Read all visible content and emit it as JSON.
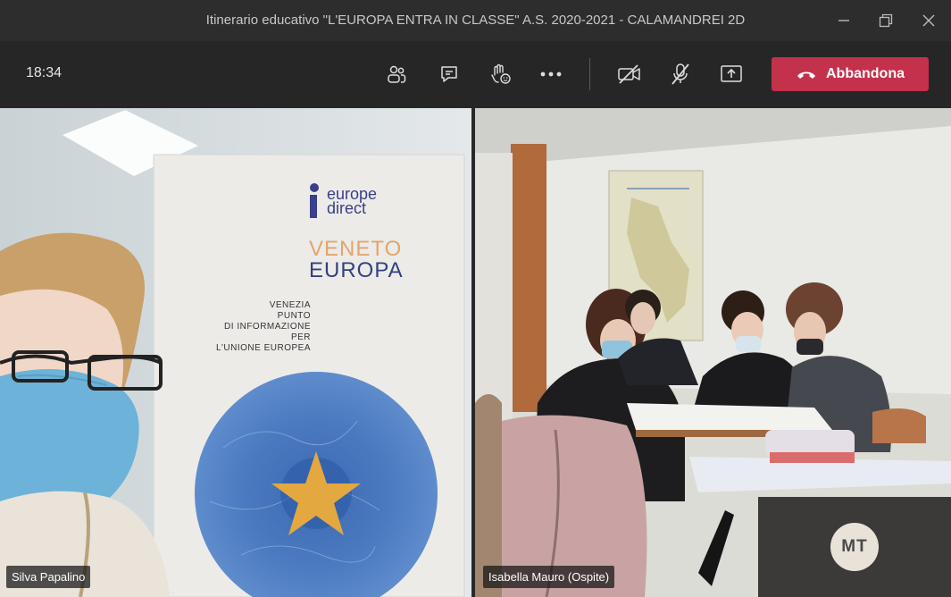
{
  "window": {
    "title": "Itinerario educativo \"L'EUROPA ENTRA IN CLASSE\" A.S. 2020-2021 - CALAMANDREI 2D"
  },
  "toolbar": {
    "clock": "18:34",
    "leave_label": "Abbandona",
    "icons": [
      "participants-icon",
      "chat-icon",
      "raise-hand-icon",
      "more-icon",
      "camera-off-icon",
      "mic-off-icon",
      "share-screen-icon",
      "phone-icon"
    ]
  },
  "banner": {
    "brand_line1": "europe",
    "brand_line2": "direct",
    "region1": "VENETO",
    "region2": "EUROPA",
    "info": [
      "VENEZIA",
      "PUNTO",
      "DI INFORMAZIONE",
      "PER",
      "L'UNIONE EUROPEA"
    ]
  },
  "participants": [
    {
      "name": "Silva Papalino"
    },
    {
      "name": "Isabella Mauro (Ospite)"
    }
  ],
  "self": {
    "initials": "MT"
  },
  "colors": {
    "leave_button": "#c4314b",
    "titlebar": "#2d2d2d",
    "toolbar": "#262626",
    "self_tile": "#3b3a39"
  }
}
